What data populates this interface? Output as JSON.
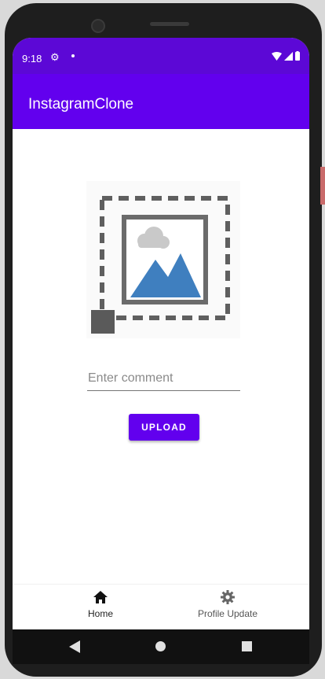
{
  "status_bar": {
    "time": "9:18"
  },
  "app_bar": {
    "title": "InstagramClone"
  },
  "comment": {
    "placeholder": "Enter comment",
    "value": ""
  },
  "upload": {
    "label": "UPLOAD"
  },
  "bottom_nav": {
    "items": [
      {
        "label": "Home",
        "icon": "home-icon",
        "selected": true
      },
      {
        "label": "Profile Update",
        "icon": "gear-icon",
        "selected": false
      }
    ]
  },
  "colors": {
    "primary": "#6200ee",
    "status_bar": "#5c08d6",
    "mountain": "#3f7fbf",
    "frame": "#6b6b6b"
  }
}
